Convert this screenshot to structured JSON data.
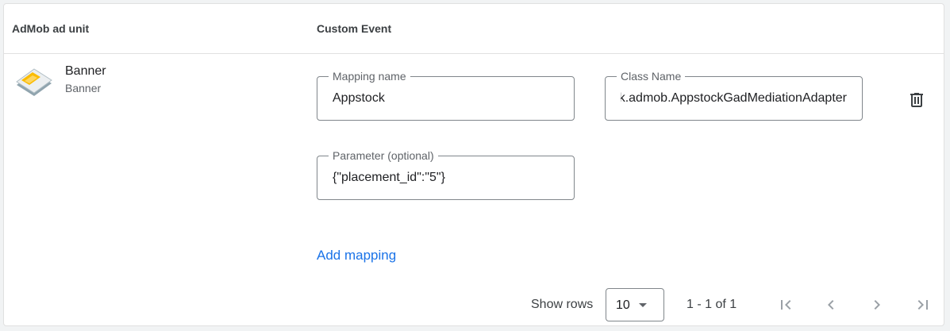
{
  "table": {
    "columns": {
      "ad_unit": "AdMob ad unit",
      "custom_event": "Custom Event"
    }
  },
  "row": {
    "ad_unit_name": "Banner",
    "ad_unit_format": "Banner",
    "mapping_name_label": "Mapping name",
    "mapping_name_value": "Appstock",
    "class_name_label": "Class Name",
    "class_name_value": "com.appstock.sdk.admob.AppstockGadMediationAdapter",
    "parameter_label": "Parameter (optional)",
    "parameter_value": "{\"placement_id\":\"5\"}",
    "delete_icon": "trash-icon"
  },
  "add_mapping_label": "Add mapping",
  "pagination": {
    "show_rows_label": "Show rows",
    "rows_value": "10",
    "range_text": "1 - 1 of 1",
    "icons": [
      "first-page-icon",
      "previous-page-icon",
      "next-page-icon",
      "last-page-icon"
    ]
  },
  "colors": {
    "accent": "#1a73e8",
    "border": "#80868b",
    "icon": "#5f6368"
  }
}
